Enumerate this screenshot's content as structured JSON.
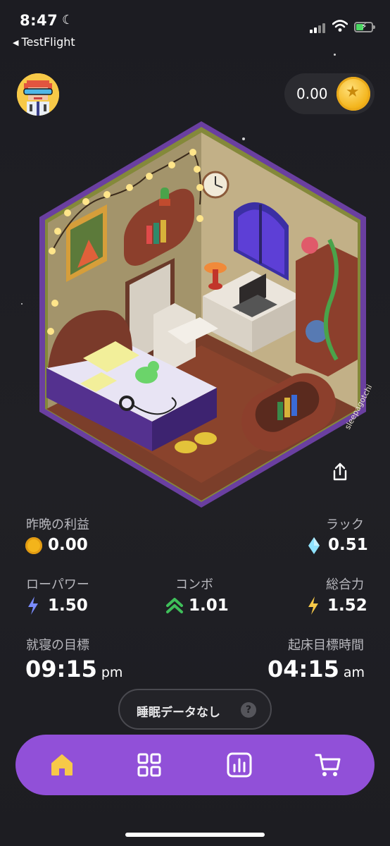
{
  "status_bar": {
    "time": "8:47",
    "back_label": "TestFlight"
  },
  "header": {
    "coin_balance": "0.00",
    "coin_icon": "star-coin-icon",
    "avatar_icon": "pixel-avatar-icon"
  },
  "room": {
    "watermark": "sleepagotchi"
  },
  "stats": {
    "last_night_profit_label": "昨晩の利益",
    "last_night_profit_value": "0.00",
    "luck_label": "ラック",
    "luck_value": "0.51",
    "low_power_label": "ローパワー",
    "low_power_value": "1.50",
    "combo_label": "コンボ",
    "combo_value": "1.01",
    "total_power_label": "総合力",
    "total_power_value": "1.52",
    "bedtime_goal_label": "就寝の目標",
    "bedtime_goal_time": "09:15",
    "bedtime_goal_ampm": "pm",
    "wake_goal_label": "起床目標時間",
    "wake_goal_time": "04:15",
    "wake_goal_ampm": "am"
  },
  "no_sleep_data_label": "睡眠データなし",
  "help_symbol": "?",
  "tabs": [
    {
      "name": "home",
      "icon": "home-icon",
      "active": true
    },
    {
      "name": "grid",
      "icon": "grid-icon",
      "active": false
    },
    {
      "name": "stats",
      "icon": "bar-chart-icon",
      "active": false
    },
    {
      "name": "shop",
      "icon": "cart-icon",
      "active": false
    }
  ],
  "colors": {
    "accent_purple": "#9150d8",
    "active_tab": "#f7c948",
    "coin": "#f3b41b",
    "combo_green": "#3fbf5a",
    "bolt_blue": "#7a8cff",
    "bolt_yellow": "#f7c948"
  }
}
